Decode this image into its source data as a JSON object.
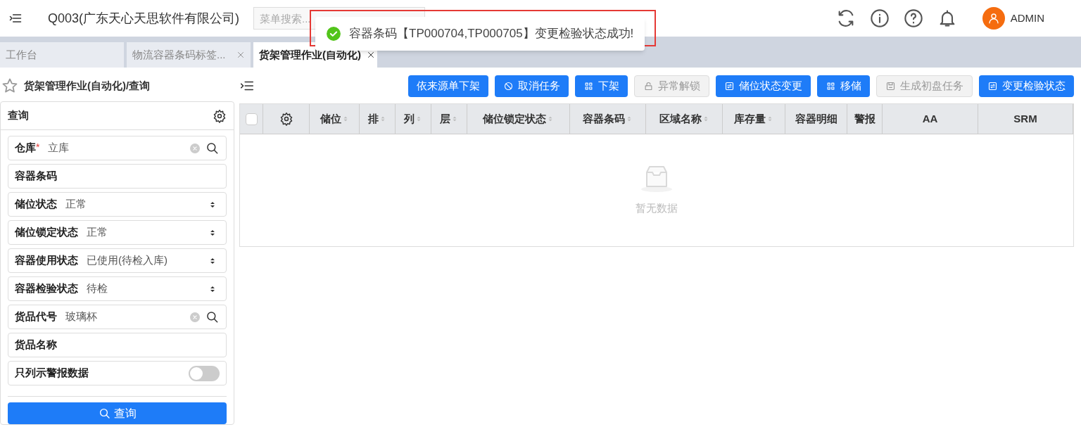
{
  "header": {
    "company": "Q003(广东天心天思软件有限公司)",
    "search": {
      "placeholder": "菜单搜索..."
    },
    "user": "ADMIN"
  },
  "tabs": [
    {
      "label": "工作台",
      "selected": false,
      "closable": false
    },
    {
      "label": "物流容器条码标签...",
      "selected": false,
      "closable": true
    },
    {
      "label": "货架管理作业(自动化)",
      "selected": true,
      "closable": true
    }
  ],
  "toast": {
    "message": "容器条码【TP000704,TP000705】变更检验状态成功!"
  },
  "breadcrumb": "货架管理作业(自动化)/查询",
  "toolbar": [
    {
      "label": "依来源单下架",
      "disabled": false
    },
    {
      "label": "取消任务",
      "disabled": false
    },
    {
      "label": "下架",
      "disabled": false
    },
    {
      "label": "异常解锁",
      "disabled": true
    },
    {
      "label": "储位状态变更",
      "disabled": false
    },
    {
      "label": "移储",
      "disabled": false
    },
    {
      "label": "生成初盘任务",
      "disabled": true
    },
    {
      "label": "变更检验状态",
      "disabled": false
    }
  ],
  "query_panel": {
    "title": "查询",
    "fields": [
      {
        "kind": "lookup",
        "label": "仓库",
        "required_mark": "*",
        "value": "立库"
      },
      {
        "kind": "text",
        "label": "容器条码"
      },
      {
        "kind": "select",
        "label": "储位状态",
        "value": "正常"
      },
      {
        "kind": "select",
        "label": "储位锁定状态",
        "value": "正常"
      },
      {
        "kind": "select",
        "label": "容器使用状态",
        "value": "已使用(待检入库)"
      },
      {
        "kind": "select",
        "label": "容器检验状态",
        "value": "待检"
      },
      {
        "kind": "lookup",
        "label": "货品代号",
        "value": "玻璃杯"
      },
      {
        "kind": "text",
        "label": "货品名称"
      },
      {
        "kind": "toggle",
        "label": "只列示警报数据",
        "on": false
      }
    ],
    "submit": "查询"
  },
  "table": {
    "select_all_checked": false,
    "columns": [
      {
        "label": "储位",
        "sortable": true
      },
      {
        "label": "排",
        "sortable": true
      },
      {
        "label": "列",
        "sortable": true
      },
      {
        "label": "层",
        "sortable": true
      },
      {
        "label": "储位锁定状态",
        "sortable": true
      },
      {
        "label": "容器条码",
        "sortable": true
      },
      {
        "label": "区域名称",
        "sortable": true
      },
      {
        "label": "库存量",
        "sortable": true
      },
      {
        "label": "容器明细",
        "sortable": false
      },
      {
        "label": "警报",
        "sortable": false
      },
      {
        "label": "AA",
        "sortable": false
      },
      {
        "label": "SRM",
        "sortable": false
      }
    ],
    "empty_text": "暂无数据"
  }
}
